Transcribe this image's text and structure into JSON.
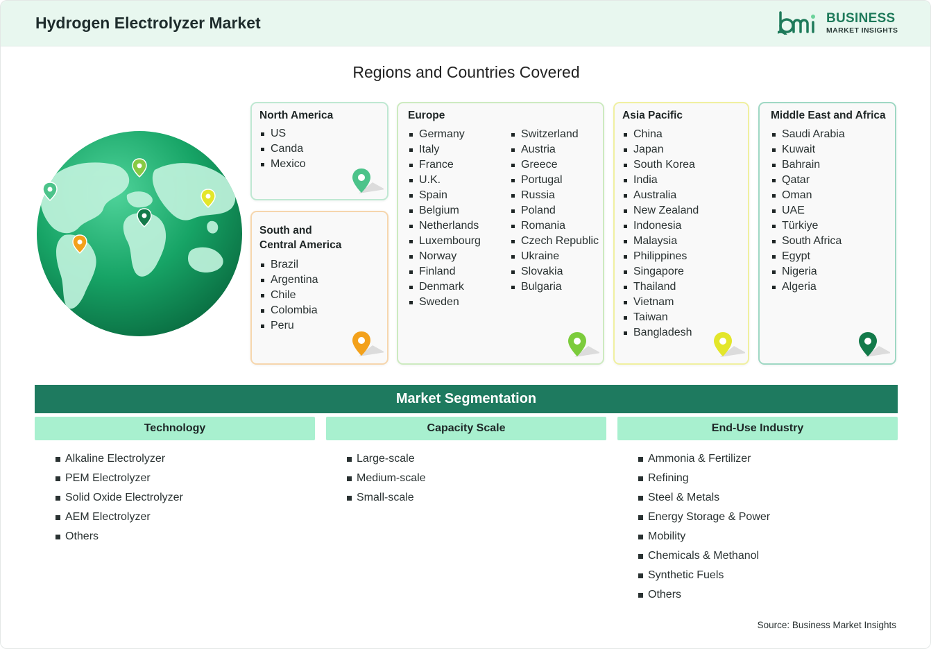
{
  "header": {
    "title": "Hydrogen Electrolyzer Market",
    "logo": {
      "mark": "bmi",
      "line1": "BUSINESS",
      "line2": "MARKET INSIGHTS",
      "brand_color": "#1e7a5a"
    }
  },
  "regions": {
    "title": "Regions and Countries Covered",
    "north_america": {
      "title": "North America",
      "items": [
        "US",
        "Canda",
        "Mexico"
      ],
      "pin_color": "#4cc38a"
    },
    "south_central_america": {
      "title_line1": "South and",
      "title_line2": "Central America",
      "items": [
        "Brazil",
        "Argentina",
        "Chile",
        "Colombia",
        "Peru"
      ],
      "pin_color": "#f3a11b"
    },
    "europe": {
      "title": "Europe",
      "col1": [
        "Germany",
        "Italy",
        "France",
        "U.K.",
        "Spain",
        "Belgium",
        "Netherlands",
        "Luxembourg",
        "Norway",
        "Finland",
        "Denmark",
        "Sweden"
      ],
      "col2": [
        "Switzerland",
        "Austria",
        "Greece",
        "Portugal",
        "Russia",
        "Poland",
        "Romania",
        "Czech Republic",
        "Ukraine",
        "Slovakia",
        "Bulgaria"
      ],
      "pin_color": "#7ccc3c"
    },
    "asia_pacific": {
      "title": "Asia Pacific",
      "items": [
        "China",
        "Japan",
        "South Korea",
        "India",
        "Australia",
        "New Zealand",
        "Indonesia",
        "Malaysia",
        "Philippines",
        "Singapore",
        "Thailand",
        "Vietnam",
        "Taiwan",
        "Bangladesh"
      ],
      "pin_color": "#e3e62a"
    },
    "middle_east_africa": {
      "title": "Middle East and Africa",
      "items": [
        "Saudi Arabia",
        "Kuwait",
        "Bahrain",
        "Qatar",
        "Oman",
        "UAE",
        "Türkiye",
        "South Africa",
        "Egypt",
        "Nigeria",
        "Algeria"
      ],
      "pin_color": "#137a4a"
    }
  },
  "segmentation": {
    "title": "Market Segmentation",
    "technology": {
      "title": "Technology",
      "items": [
        "Alkaline Electrolyzer",
        "PEM Electrolyzer",
        "Solid Oxide Electrolyzer",
        "AEM Electrolyzer",
        "Others"
      ]
    },
    "capacity": {
      "title": "Capacity Scale",
      "items": [
        "Large-scale",
        "Medium-scale",
        "Small-scale"
      ]
    },
    "end_use": {
      "title": "End-Use Industry",
      "items": [
        "Ammonia & Fertilizer",
        "Refining",
        "Steel & Metals",
        "Energy Storage & Power",
        "Mobility",
        "Chemicals & Methanol",
        "Synthetic Fuels",
        "Others"
      ]
    }
  },
  "source": "Source: Business Market Insights"
}
